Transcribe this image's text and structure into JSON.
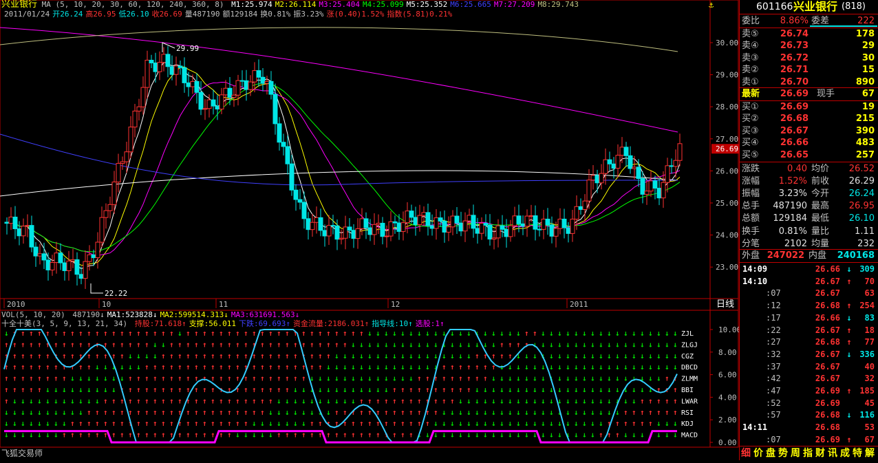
{
  "app": {
    "name": "飞狐交易师"
  },
  "stock": {
    "code": "601166",
    "name": "兴业银行",
    "market": "(818)"
  },
  "main_chart": {
    "title": "兴业银行",
    "ma_header": "MA (5, 10, 20, 30, 60, 120, 240, 360, 8)",
    "ma_values": [
      {
        "label": "M1:25.974",
        "color": "#ffffff"
      },
      {
        "label": "M2:26.114",
        "color": "#ffff00"
      },
      {
        "label": "M3:25.404",
        "color": "#ff00ff"
      },
      {
        "label": "M4:25.099",
        "color": "#00ff00"
      },
      {
        "label": "M5:25.352",
        "color": "#ffffff"
      },
      {
        "label": "M6:25.665",
        "color": "#4040ff"
      },
      {
        "label": "M7:27.209",
        "color": "#ff00ff"
      },
      {
        "label": "M8:29.743",
        "color": "#c0c080"
      }
    ],
    "info_line": [
      {
        "text": "2011/01/24",
        "color": "#c0c0c0"
      },
      {
        "text": "开26.24",
        "color": "#00e6e6"
      },
      {
        "text": "高26.95",
        "color": "#ff3232"
      },
      {
        "text": "低26.10",
        "color": "#00e6e6"
      },
      {
        "text": "收26.69",
        "color": "#ff3232"
      },
      {
        "text": "量487190",
        "color": "#c0c0c0"
      },
      {
        "text": "额129184",
        "color": "#c0c0c0"
      },
      {
        "text": "换0.81%",
        "color": "#c0c0c0"
      },
      {
        "text": "振3.23%",
        "color": "#c0c0c0"
      },
      {
        "text": "涨(0.40)1.52%",
        "color": "#ff3232"
      },
      {
        "text": "指数(5.81)0.21%",
        "color": "#ff3232"
      }
    ],
    "y_ticks": [
      "30.00",
      "29.00",
      "28.00",
      "27.00",
      "26.00",
      "25.00",
      "24.00",
      "23.00"
    ],
    "current_price": "26.69",
    "high_label": "29.99",
    "low_label": "22.22",
    "x_labels": [
      "2010",
      "10",
      "11",
      "12",
      "2011"
    ],
    "period_label": "日线"
  },
  "lower_chart": {
    "vol_header": "VOL(5, 10, 20)",
    "vol_values": [
      {
        "text": "487190↓",
        "color": "#c0c0c0"
      },
      {
        "text": "MA1:523828↓",
        "color": "#ffffff"
      },
      {
        "text": "MA2:599514.313↓",
        "color": "#ffff00"
      },
      {
        "text": "MA3:631691.563↓",
        "color": "#ff00ff"
      }
    ],
    "indicator_header": "十全十美(3, 5, 9, 13, 21, 34)",
    "indicator_values": [
      {
        "text": "持股:71.618↑",
        "color": "#ff3232"
      },
      {
        "text": "支撑:56.011",
        "color": "#ffff00"
      },
      {
        "text": "下跌:69.693↑",
        "color": "#4040ff"
      },
      {
        "text": "资金流量:2186.031↑",
        "color": "#ff3232"
      },
      {
        "text": "指导线:10↑",
        "color": "#00e6e6"
      },
      {
        "text": "选股:1↑",
        "color": "#ff00ff"
      }
    ],
    "y_ticks": [
      "10.00",
      "8.00",
      "6.00",
      "4.00",
      "2.00",
      "0.00"
    ],
    "row_labels": [
      "ZJL",
      "ZLGJ",
      "CGZ",
      "DBCD",
      "ZLMM",
      "BBI",
      "LWAR",
      "RSI",
      "KDJ",
      "MACD"
    ]
  },
  "quote_panel": {
    "webi_label": "委比",
    "webi_value": "8.86%",
    "weicha_label": "委差",
    "weicha_value": "222",
    "asks": [
      {
        "label": "卖⑤",
        "price": "26.74",
        "vol": "178"
      },
      {
        "label": "卖④",
        "price": "26.73",
        "vol": "29"
      },
      {
        "label": "卖③",
        "price": "26.72",
        "vol": "30"
      },
      {
        "label": "卖②",
        "price": "26.71",
        "vol": "15"
      },
      {
        "label": "卖①",
        "price": "26.70",
        "vol": "890"
      }
    ],
    "latest_label": "最新",
    "latest_value": "26.69",
    "xianshou_label": "现手",
    "xianshou_value": "67",
    "bids": [
      {
        "label": "买①",
        "price": "26.69",
        "vol": "19"
      },
      {
        "label": "买②",
        "price": "26.68",
        "vol": "215"
      },
      {
        "label": "买③",
        "price": "26.67",
        "vol": "390"
      },
      {
        "label": "买④",
        "price": "26.66",
        "vol": "483"
      },
      {
        "label": "买⑤",
        "price": "26.65",
        "vol": "257"
      }
    ],
    "stats": [
      {
        "l1": "涨跌",
        "v1": "0.40",
        "c1": "#ff3232",
        "l2": "均价",
        "v2": "26.52",
        "c2": "#ff3232"
      },
      {
        "l1": "涨幅",
        "v1": "1.52%",
        "c1": "#ff3232",
        "l2": "前收",
        "v2": "26.29",
        "c2": "#e0e0e0"
      },
      {
        "l1": "振幅",
        "v1": "3.23%",
        "c1": "#e0e0e0",
        "l2": "今开",
        "v2": "26.24",
        "c2": "#00e6e6"
      },
      {
        "l1": "总手",
        "v1": "487190",
        "c1": "#e0e0e0",
        "l2": "最高",
        "v2": "26.95",
        "c2": "#ff3232"
      },
      {
        "l1": "总额",
        "v1": "129184",
        "c1": "#e0e0e0",
        "l2": "最低",
        "v2": "26.10",
        "c2": "#00e6e6"
      },
      {
        "l1": "换手",
        "v1": "0.81%",
        "c1": "#e0e0e0",
        "l2": "量比",
        "v2": "1.11",
        "c2": "#e0e0e0"
      },
      {
        "l1": "分笔",
        "v1": "2102",
        "c1": "#e0e0e0",
        "l2": "均量",
        "v2": "232",
        "c2": "#e0e0e0"
      }
    ],
    "waipan_label": "外盘",
    "waipan_value": "247022",
    "neipan_label": "内盘",
    "neipan_value": "240168",
    "ticks": [
      {
        "time": "14:09",
        "price": "26.66",
        "dir": "dn",
        "vol": "309"
      },
      {
        "time": "14:10",
        "price": "26.67",
        "dir": "up",
        "vol": "70"
      },
      {
        "time": ":07",
        "price": "26.67",
        "dir": "",
        "vol": "63"
      },
      {
        "time": ":12",
        "price": "26.68",
        "dir": "up",
        "vol": "254"
      },
      {
        "time": ":17",
        "price": "26.66",
        "dir": "dn",
        "vol": "83"
      },
      {
        "time": ":22",
        "price": "26.67",
        "dir": "up",
        "vol": "18"
      },
      {
        "time": ":27",
        "price": "26.68",
        "dir": "up",
        "vol": "77"
      },
      {
        "time": ":32",
        "price": "26.67",
        "dir": "dn",
        "vol": "336"
      },
      {
        "time": ":37",
        "price": "26.67",
        "dir": "",
        "vol": "40"
      },
      {
        "time": ":42",
        "price": "26.67",
        "dir": "",
        "vol": "32"
      },
      {
        "time": ":47",
        "price": "26.69",
        "dir": "up",
        "vol": "185"
      },
      {
        "time": ":52",
        "price": "26.69",
        "dir": "",
        "vol": "45"
      },
      {
        "time": ":57",
        "price": "26.68",
        "dir": "dn",
        "vol": "116"
      },
      {
        "time": "14:11",
        "price": "26.68",
        "dir": "",
        "vol": "53"
      },
      {
        "time": ":07",
        "price": "26.69",
        "dir": "up",
        "vol": "67"
      }
    ],
    "bottom_tabs": [
      "细",
      "价",
      "盘",
      "势",
      "周",
      "指",
      "财",
      "讯",
      "成",
      "特",
      "解"
    ]
  },
  "colors": {
    "up": "#ff3232",
    "down": "#00e6e6",
    "frame": "#c00000",
    "text": "#c0c0c0"
  }
}
